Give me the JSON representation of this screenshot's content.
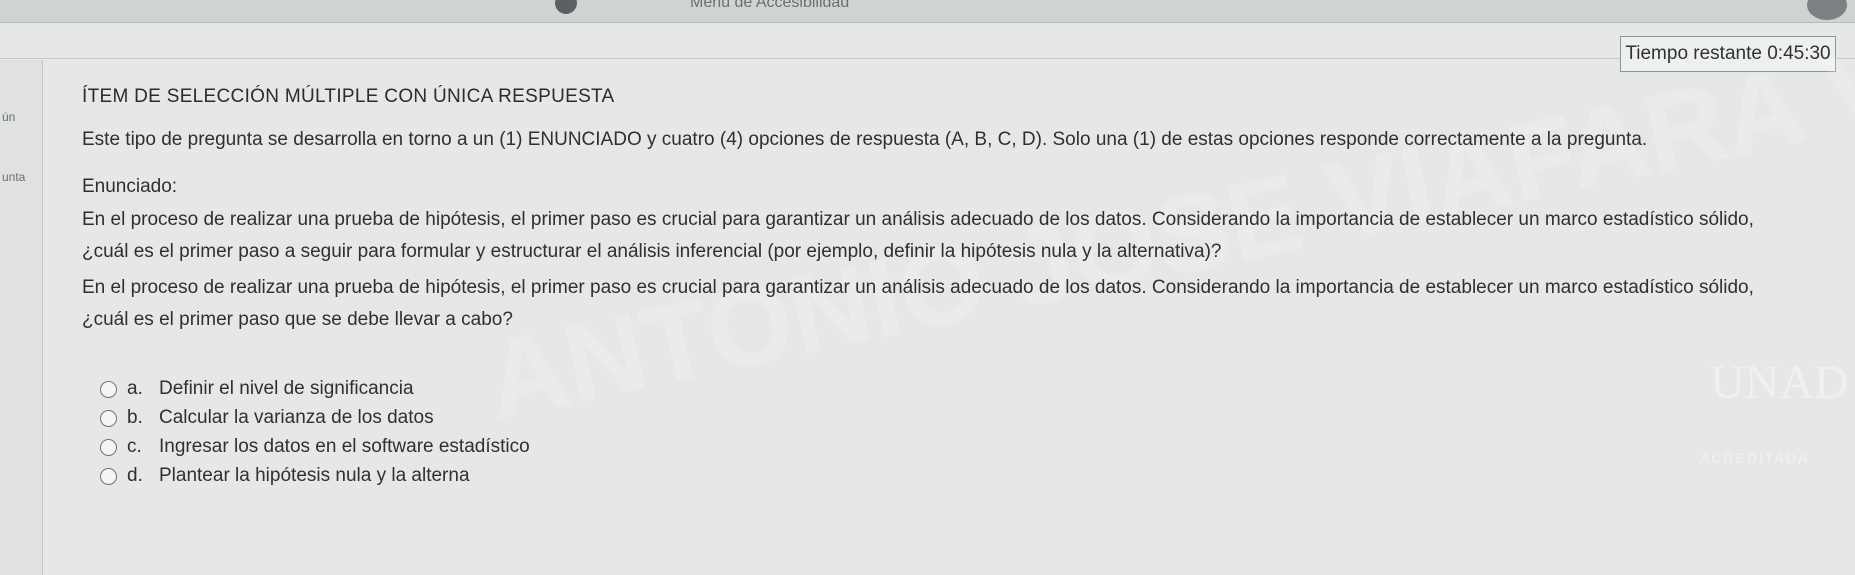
{
  "window": {
    "title": "Menú de Accesibilidad"
  },
  "left_fragments": [
    "ún",
    "unta"
  ],
  "timer": {
    "text": "Tiempo restante 0:45:30"
  },
  "question": {
    "heading": "ÍTEM DE SELECCIÓN MÚLTIPLE CON ÚNICA RESPUESTA",
    "instructions": "Este tipo de pregunta se desarrolla en torno a un (1) ENUNCIADO y cuatro (4) opciones de respuesta (A, B, C, D). Solo una (1) de estas opciones responde correctamente a la pregunta.",
    "enunciado_label": "Enunciado:",
    "enunciado_line1": "En el proceso de realizar una prueba de hipótesis, el primer paso es crucial para garantizar un análisis adecuado de los datos. Considerando la importancia de establecer un marco estadístico sólido,",
    "enunciado_line2": "¿cuál es el primer paso a seguir para formular y estructurar el análisis inferencial (por ejemplo, definir la hipótesis nula y la alternativa)?",
    "repeat_line1": "En el proceso de realizar una prueba de hipótesis, el primer paso es crucial para garantizar un análisis adecuado de los datos. Considerando la importancia de establecer un marco estadístico sólido,",
    "repeat_line2": "¿cuál es el primer paso que se debe llevar a cabo?",
    "options": [
      {
        "letter": "a.",
        "text": "Definir el nivel de significancia"
      },
      {
        "letter": "b.",
        "text": "Calcular la varianza de los datos"
      },
      {
        "letter": "c.",
        "text": "Ingresar los datos en el software estadístico"
      },
      {
        "letter": "d.",
        "text": "Plantear la hipótesis nula y la alterna"
      }
    ]
  },
  "watermark": {
    "text": "ANTONIO JOSE VIAFARA VELEZ"
  },
  "logo": {
    "text": "UNAD",
    "badge": "ACREDITADA"
  }
}
